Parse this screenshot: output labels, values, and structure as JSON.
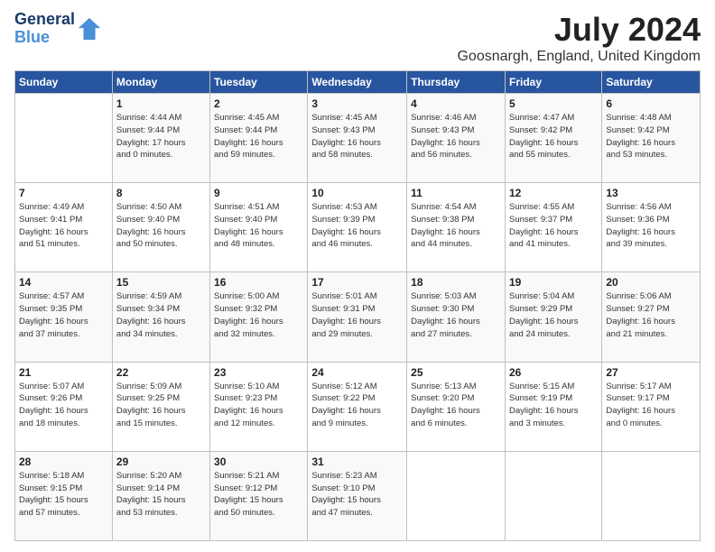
{
  "header": {
    "logo_line1": "General",
    "logo_line2": "Blue",
    "month_title": "July 2024",
    "location": "Goosnargh, England, United Kingdom"
  },
  "columns": [
    "Sunday",
    "Monday",
    "Tuesday",
    "Wednesday",
    "Thursday",
    "Friday",
    "Saturday"
  ],
  "weeks": [
    [
      {
        "day": "",
        "info": ""
      },
      {
        "day": "1",
        "info": "Sunrise: 4:44 AM\nSunset: 9:44 PM\nDaylight: 17 hours\nand 0 minutes."
      },
      {
        "day": "2",
        "info": "Sunrise: 4:45 AM\nSunset: 9:44 PM\nDaylight: 16 hours\nand 59 minutes."
      },
      {
        "day": "3",
        "info": "Sunrise: 4:45 AM\nSunset: 9:43 PM\nDaylight: 16 hours\nand 58 minutes."
      },
      {
        "day": "4",
        "info": "Sunrise: 4:46 AM\nSunset: 9:43 PM\nDaylight: 16 hours\nand 56 minutes."
      },
      {
        "day": "5",
        "info": "Sunrise: 4:47 AM\nSunset: 9:42 PM\nDaylight: 16 hours\nand 55 minutes."
      },
      {
        "day": "6",
        "info": "Sunrise: 4:48 AM\nSunset: 9:42 PM\nDaylight: 16 hours\nand 53 minutes."
      }
    ],
    [
      {
        "day": "7",
        "info": "Sunrise: 4:49 AM\nSunset: 9:41 PM\nDaylight: 16 hours\nand 51 minutes."
      },
      {
        "day": "8",
        "info": "Sunrise: 4:50 AM\nSunset: 9:40 PM\nDaylight: 16 hours\nand 50 minutes."
      },
      {
        "day": "9",
        "info": "Sunrise: 4:51 AM\nSunset: 9:40 PM\nDaylight: 16 hours\nand 48 minutes."
      },
      {
        "day": "10",
        "info": "Sunrise: 4:53 AM\nSunset: 9:39 PM\nDaylight: 16 hours\nand 46 minutes."
      },
      {
        "day": "11",
        "info": "Sunrise: 4:54 AM\nSunset: 9:38 PM\nDaylight: 16 hours\nand 44 minutes."
      },
      {
        "day": "12",
        "info": "Sunrise: 4:55 AM\nSunset: 9:37 PM\nDaylight: 16 hours\nand 41 minutes."
      },
      {
        "day": "13",
        "info": "Sunrise: 4:56 AM\nSunset: 9:36 PM\nDaylight: 16 hours\nand 39 minutes."
      }
    ],
    [
      {
        "day": "14",
        "info": "Sunrise: 4:57 AM\nSunset: 9:35 PM\nDaylight: 16 hours\nand 37 minutes."
      },
      {
        "day": "15",
        "info": "Sunrise: 4:59 AM\nSunset: 9:34 PM\nDaylight: 16 hours\nand 34 minutes."
      },
      {
        "day": "16",
        "info": "Sunrise: 5:00 AM\nSunset: 9:32 PM\nDaylight: 16 hours\nand 32 minutes."
      },
      {
        "day": "17",
        "info": "Sunrise: 5:01 AM\nSunset: 9:31 PM\nDaylight: 16 hours\nand 29 minutes."
      },
      {
        "day": "18",
        "info": "Sunrise: 5:03 AM\nSunset: 9:30 PM\nDaylight: 16 hours\nand 27 minutes."
      },
      {
        "day": "19",
        "info": "Sunrise: 5:04 AM\nSunset: 9:29 PM\nDaylight: 16 hours\nand 24 minutes."
      },
      {
        "day": "20",
        "info": "Sunrise: 5:06 AM\nSunset: 9:27 PM\nDaylight: 16 hours\nand 21 minutes."
      }
    ],
    [
      {
        "day": "21",
        "info": "Sunrise: 5:07 AM\nSunset: 9:26 PM\nDaylight: 16 hours\nand 18 minutes."
      },
      {
        "day": "22",
        "info": "Sunrise: 5:09 AM\nSunset: 9:25 PM\nDaylight: 16 hours\nand 15 minutes."
      },
      {
        "day": "23",
        "info": "Sunrise: 5:10 AM\nSunset: 9:23 PM\nDaylight: 16 hours\nand 12 minutes."
      },
      {
        "day": "24",
        "info": "Sunrise: 5:12 AM\nSunset: 9:22 PM\nDaylight: 16 hours\nand 9 minutes."
      },
      {
        "day": "25",
        "info": "Sunrise: 5:13 AM\nSunset: 9:20 PM\nDaylight: 16 hours\nand 6 minutes."
      },
      {
        "day": "26",
        "info": "Sunrise: 5:15 AM\nSunset: 9:19 PM\nDaylight: 16 hours\nand 3 minutes."
      },
      {
        "day": "27",
        "info": "Sunrise: 5:17 AM\nSunset: 9:17 PM\nDaylight: 16 hours\nand 0 minutes."
      }
    ],
    [
      {
        "day": "28",
        "info": "Sunrise: 5:18 AM\nSunset: 9:15 PM\nDaylight: 15 hours\nand 57 minutes."
      },
      {
        "day": "29",
        "info": "Sunrise: 5:20 AM\nSunset: 9:14 PM\nDaylight: 15 hours\nand 53 minutes."
      },
      {
        "day": "30",
        "info": "Sunrise: 5:21 AM\nSunset: 9:12 PM\nDaylight: 15 hours\nand 50 minutes."
      },
      {
        "day": "31",
        "info": "Sunrise: 5:23 AM\nSunset: 9:10 PM\nDaylight: 15 hours\nand 47 minutes."
      },
      {
        "day": "",
        "info": ""
      },
      {
        "day": "",
        "info": ""
      },
      {
        "day": "",
        "info": ""
      }
    ]
  ]
}
